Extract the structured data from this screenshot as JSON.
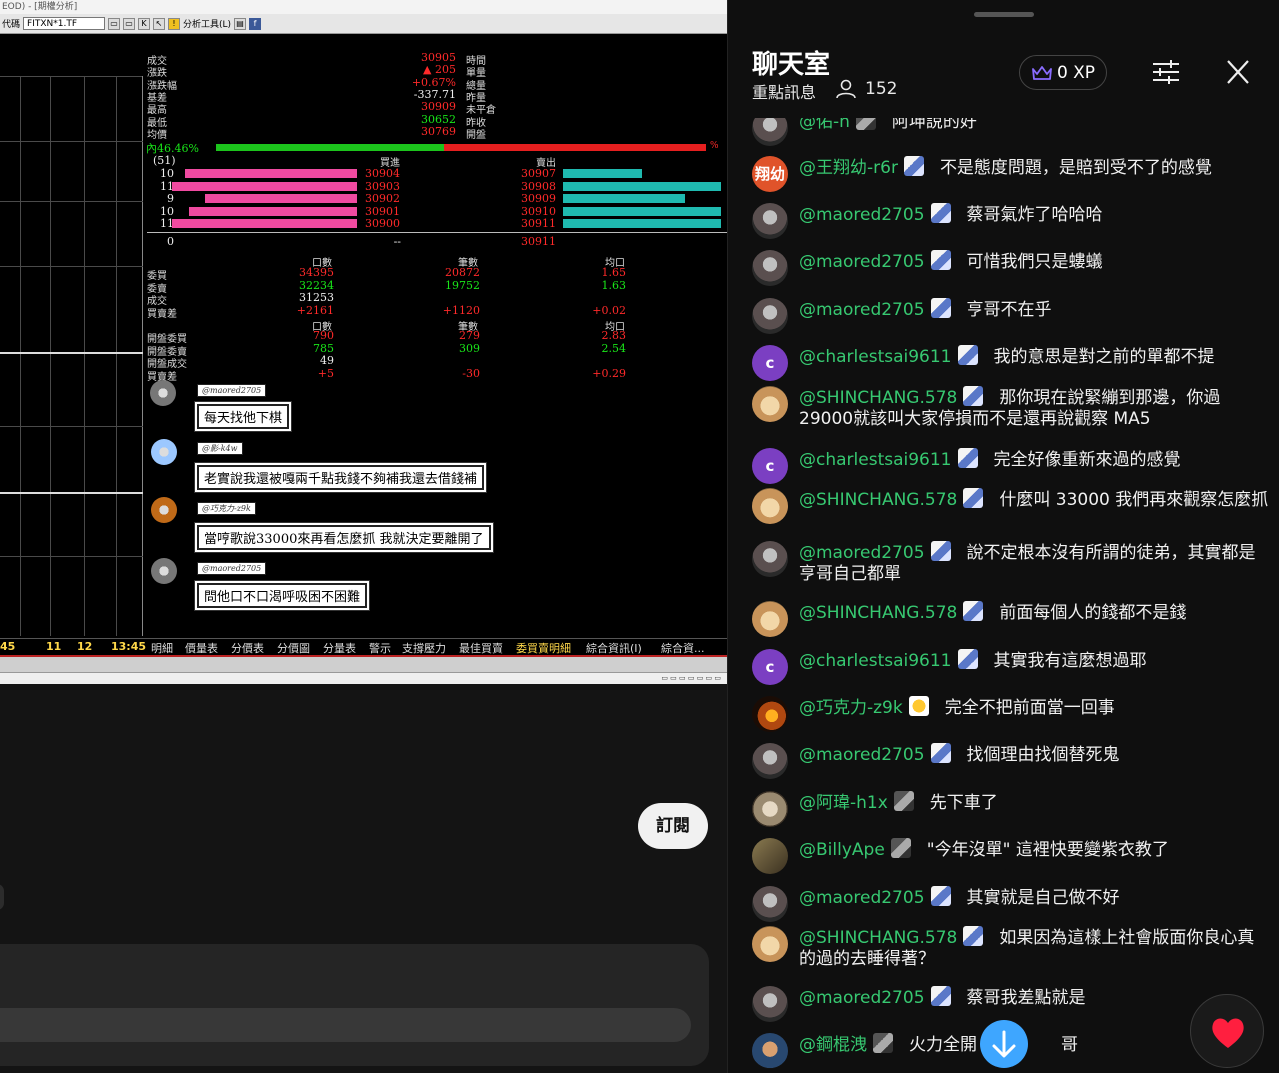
{
  "window": {
    "title": "EOD) - [期權分析]",
    "code_label": "代碼",
    "symbol": "FITXN*1.TF",
    "analysis_label": "分析工具(L)"
  },
  "quote": {
    "labels_left": [
      "成交",
      "漲跌",
      "漲跌幅",
      "基差",
      "最高",
      "最低",
      "均價"
    ],
    "values_left": [
      "30905",
      "▲ 205",
      "+0.67%",
      "-337.71",
      "30909",
      "30652",
      "30769"
    ],
    "values_left_colors": [
      "#ff2a2a",
      "#ff2a2a",
      "#ff2a2a",
      "#eeeeee",
      "#ff2a2a",
      "#19e619",
      "#ff2a2a"
    ],
    "labels_right": [
      "時間",
      "單量",
      "總量",
      "昨量",
      "未平倉",
      "昨收",
      "開盤"
    ],
    "inner_ratio_label": "內46.46%",
    "inner_ratio": 0.4646,
    "outer_ratio_label": "%",
    "depth_count": "(51)",
    "bid_header": "買進",
    "ask_header": "賣出",
    "bid_sizes": [
      "10",
      "11",
      "9",
      "10",
      "11"
    ],
    "bid_prices": [
      "30904",
      "30903",
      "30902",
      "30901",
      "30900"
    ],
    "ask_prices": [
      "30907",
      "30908",
      "30909",
      "30910",
      "30911"
    ],
    "bid_bar_levels": [
      0.52,
      0.56,
      0.46,
      0.51,
      0.56
    ],
    "ask_bar_levels": [
      0.24,
      0.48,
      0.37,
      0.48,
      0.48
    ],
    "depth_total_left": "0",
    "depth_total_mid": "--",
    "depth_total_right": "30911"
  },
  "stats": {
    "col1_header": "口數",
    "col2_header": "筆數",
    "col3_header": "均口",
    "rows1": [
      {
        "label": "委買",
        "c1": "34395",
        "c2": "20872",
        "c3": "1.65",
        "color": "#ff2a2a"
      },
      {
        "label": "委賣",
        "c1": "32234",
        "c2": "19752",
        "c3": "1.63",
        "color": "#19e619"
      },
      {
        "label": "成交",
        "c1": "31253",
        "c2": "",
        "c3": "",
        "color": "#eeeeee"
      },
      {
        "label": "買賣差",
        "c1": "+2161",
        "c2": "+1120",
        "c3": "+0.02",
        "color": "#ff2a2a"
      }
    ],
    "rows2": [
      {
        "label": "開盤委買",
        "c1": "790",
        "c2": "279",
        "c3": "2.83",
        "color": "#ff2a2a"
      },
      {
        "label": "開盤委賣",
        "c1": "785",
        "c2": "309",
        "c3": "2.54",
        "color": "#19e619"
      },
      {
        "label": "開盤成交",
        "c1": "49",
        "c2": "",
        "c3": "",
        "color": "#eeeeee"
      },
      {
        "label": "買賣差",
        "c1": "+5",
        "c2": "-30",
        "c3": "+0.29",
        "color": "#ff2a2a"
      }
    ]
  },
  "overlay_comments": [
    {
      "name": "@maored2705",
      "text": "每天找他下棋"
    },
    {
      "name": "@影-k4w",
      "text": "老實說我還被嘎兩千點我錢不夠補我還去借錢補"
    },
    {
      "name": "@巧克力-z9k",
      "text": "當哼歌說33000來再看怎麼抓 我就決定要離開了"
    },
    {
      "name": "@maored2705",
      "text": "問他口不口渴呼吸困不困難"
    }
  ],
  "bottom_tabs": {
    "times": [
      "45",
      "11",
      "12",
      "13:45"
    ],
    "tabs": [
      "明細",
      "價量表",
      "分價表",
      "分價圖",
      "分量表",
      "警示",
      "支撐壓力",
      "最佳買賣",
      "委買賣明細",
      "綜合資訊(I)",
      "綜合資..."
    ]
  },
  "subscribe_label": "訂閱",
  "chat": {
    "title": "聊天室",
    "subtitle": "重點訊息",
    "viewers": "152",
    "xp": "0 XP",
    "partial_top": {
      "user": "@佑-n",
      "text": "阿坤說的好"
    },
    "messages": [
      {
        "user": "@王翔幼-r6r",
        "text": "不是態度問題，是賠到受不了的感覺",
        "avatar": "av-orange",
        "avatar_text": "翔幼",
        "badge": "blue"
      },
      {
        "user": "@maored2705",
        "text": "蔡哥氣炸了哈哈哈",
        "avatar": "av-grey",
        "avatar_text": "",
        "badge": "blue"
      },
      {
        "user": "@maored2705",
        "text": "可惜我們只是螻蟻",
        "avatar": "av-grey",
        "avatar_text": "",
        "badge": "blue"
      },
      {
        "user": "@maored2705",
        "text": "亨哥不在乎",
        "avatar": "av-grey",
        "avatar_text": "",
        "badge": "blue"
      },
      {
        "user": "@charlestsai9611",
        "text": "我的意思是對之前的單都不提",
        "avatar": "av-purple",
        "avatar_text": "c",
        "badge": "blue"
      },
      {
        "user": "@SHINCHANG.578",
        "text": "那你現在說緊繃到那邊，你過29000就該叫大家停損而不是還再說觀察 MA5",
        "avatar": "av-dog",
        "avatar_text": "",
        "badge": "blue"
      },
      {
        "user": "@charlestsai9611",
        "text": "完全好像重新來過的感覺",
        "avatar": "av-purple",
        "avatar_text": "c",
        "badge": "blue"
      },
      {
        "user": "@SHINCHANG.578",
        "text": "什麼叫 33000 我們再來觀察怎麼抓",
        "avatar": "av-dog",
        "avatar_text": "",
        "badge": "blue"
      },
      {
        "user": "@maored2705",
        "text": "說不定根本沒有所謂的徒弟，其實都是亨哥自己都單",
        "avatar": "av-grey",
        "avatar_text": "",
        "badge": "blue"
      },
      {
        "user": "@SHINCHANG.578",
        "text": "前面每個人的錢都不是錢",
        "avatar": "av-dog",
        "avatar_text": "",
        "badge": "blue"
      },
      {
        "user": "@charlestsai9611",
        "text": "其實我有這麼想過耶",
        "avatar": "av-purple",
        "avatar_text": "c",
        "badge": "blue"
      },
      {
        "user": "@巧克力-z9k",
        "text": "完全不把前面當一回事",
        "avatar": "av-fire",
        "avatar_text": "",
        "badge": "gold"
      },
      {
        "user": "@maored2705",
        "text": "找個理由找個替死鬼",
        "avatar": "av-grey",
        "avatar_text": "",
        "badge": "blue"
      },
      {
        "user": "@阿瑋-h1x",
        "text": "先下車了",
        "avatar": "av-bird",
        "avatar_text": "",
        "badge": "dark"
      },
      {
        "user": "@BillyApe",
        "text": "\"今年沒單\" 這裡快要變紫衣教了",
        "avatar": "av-ape",
        "avatar_text": "",
        "badge": "dark"
      },
      {
        "user": "@maored2705",
        "text": "其實就是自己做不好",
        "avatar": "av-grey",
        "avatar_text": "",
        "badge": "blue"
      },
      {
        "user": "@SHINCHANG.578",
        "text": "如果因為這樣上社會版面你良心真的過的去睡得著？",
        "avatar": "av-dog",
        "avatar_text": "",
        "badge": "blue"
      },
      {
        "user": "@maored2705",
        "text": "蔡哥我差點就是",
        "avatar": "av-grey",
        "avatar_text": "",
        "badge": "blue"
      },
      {
        "user": "@鋼棍洩",
        "text": "火力全開",
        "avatar": "av-man",
        "avatar_text": "",
        "badge": "dark",
        "tail": "哥"
      }
    ]
  }
}
